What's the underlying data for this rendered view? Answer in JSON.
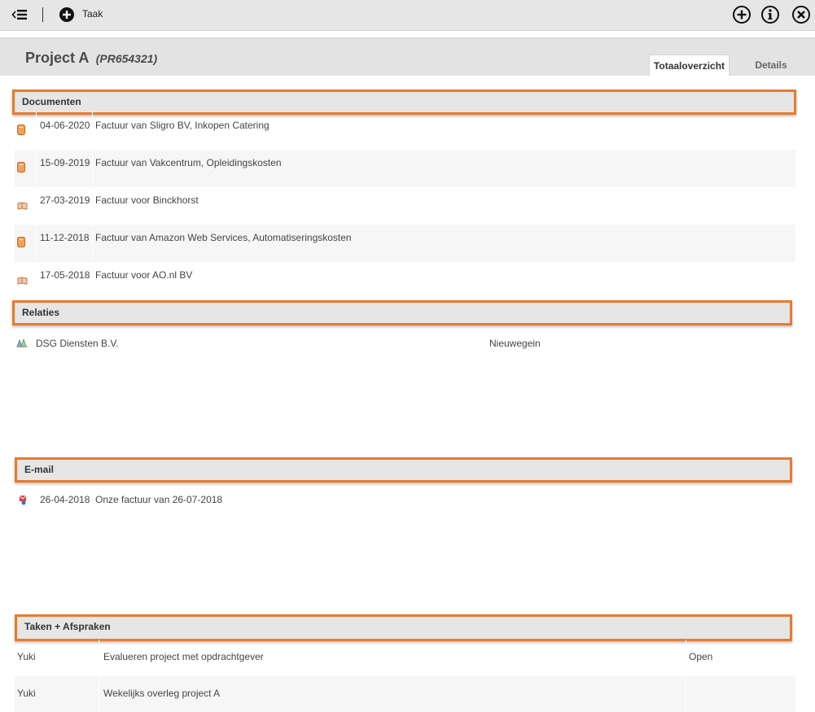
{
  "toolbar": {
    "new_task_label": "Taak",
    "colors": {
      "background": "#e6e6e6",
      "icon": "#111111"
    }
  },
  "header": {
    "title": "Project A",
    "code": "(PR654321)",
    "tabs": [
      {
        "label": "Totaaloverzicht",
        "active": true
      },
      {
        "label": "Details",
        "active": false
      }
    ]
  },
  "accent_color": "#e87a2f",
  "sections": {
    "documents": {
      "title": "Documenten",
      "rows": [
        {
          "date": "04-06-2020",
          "description": "Factuur van Sligro BV, Inkopen Catering",
          "icon": "purchase-invoice-icon"
        },
        {
          "date": "15-09-2019",
          "description": "Factuur van Vakcentrum, Opleidingskosten",
          "icon": "purchase-invoice-icon"
        },
        {
          "date": "27-03-2019",
          "description": "Factuur voor Binckhorst",
          "icon": "sales-invoice-icon"
        },
        {
          "date": "11-12-2018",
          "description": "Factuur van Amazon Web Services, Automatiseringskosten",
          "icon": "purchase-invoice-icon"
        },
        {
          "date": "17-05-2018",
          "description": "Factuur voor AO.nl BV",
          "icon": "sales-invoice-icon"
        }
      ]
    },
    "relations": {
      "title": "Relaties",
      "rows": [
        {
          "name": "DSG Diensten B.V.",
          "city": "Nieuwegein",
          "icon": "company-icon"
        }
      ]
    },
    "email": {
      "title": "E-mail",
      "rows": [
        {
          "date": "26-04-2018",
          "description": "Onze factuur van 26-07-2018",
          "icon": "email-icon"
        }
      ]
    },
    "tasks": {
      "title": "Taken + Afspraken",
      "rows": [
        {
          "who": "Yuki",
          "what": "Evalueren project met opdrachtgever",
          "status": "Open"
        },
        {
          "who": "Yuki",
          "what": "Wekelijks overleg project A",
          "status": ""
        }
      ]
    }
  }
}
